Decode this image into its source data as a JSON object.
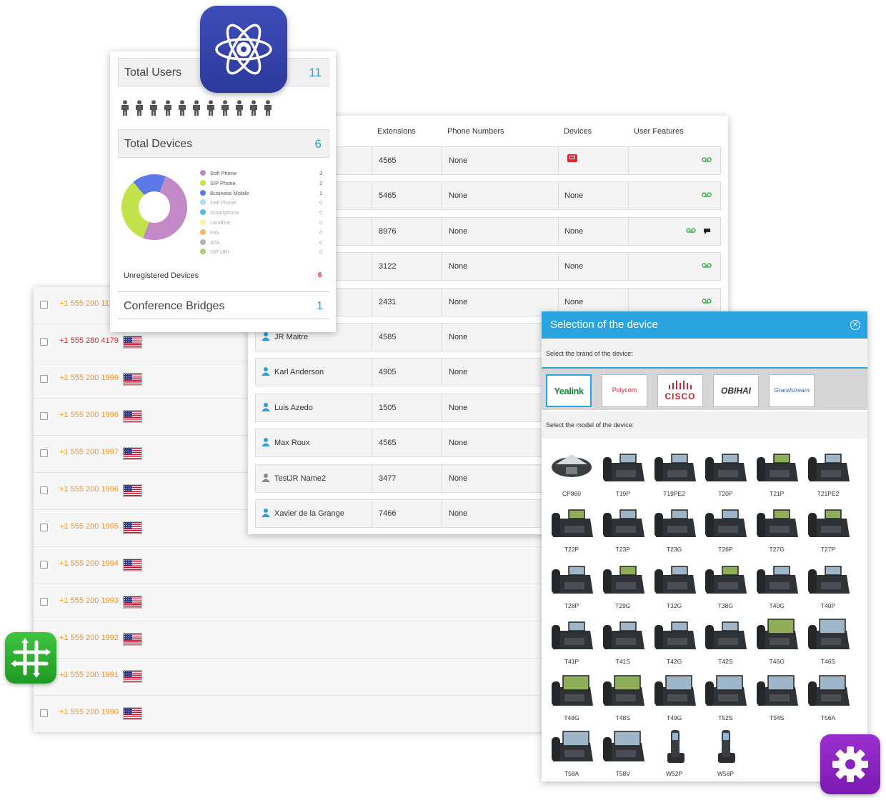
{
  "dashboard": {
    "total_users_label": "Total Users",
    "total_users_value": "11",
    "total_devices_label": "Total Devices",
    "total_devices_value": "6",
    "legend": [
      {
        "label": "Soft Phone",
        "count": "3",
        "color": "#c18ac6"
      },
      {
        "label": "SIP Phone",
        "count": "2",
        "color": "#c3e34c"
      },
      {
        "label": "Business Mobile",
        "count": "1",
        "color": "#5b78e6"
      },
      {
        "label": "Cell Phone",
        "count": "0",
        "color": "#a8dff7"
      },
      {
        "label": "Smartphone",
        "count": "0",
        "color": "#56b9e6"
      },
      {
        "label": "Landline",
        "count": "0",
        "color": "#fbf1a6"
      },
      {
        "label": "Fax",
        "count": "0",
        "color": "#f6b866"
      },
      {
        "label": "ATA",
        "count": "0",
        "color": "#b4b4b4"
      },
      {
        "label": "SIP URI",
        "count": "0",
        "color": "#a9d370"
      }
    ],
    "unregistered_label": "Unregistered Devices",
    "unregistered_value": "6",
    "conference_label": "Conference Bridges",
    "conference_value": "1"
  },
  "users_table": {
    "headers": [
      "Extensions",
      "Phone Numbers",
      "Devices",
      "User Features"
    ],
    "rows": [
      {
        "name": "",
        "ext": "4565",
        "phone": "None",
        "devices": "",
        "features": "vm"
      },
      {
        "name": "",
        "ext": "5465",
        "phone": "None",
        "devices": "None",
        "features": "vm"
      },
      {
        "name": "",
        "ext": "8976",
        "phone": "None",
        "devices": "None",
        "features": "vm-chat"
      },
      {
        "name": "",
        "ext": "3122",
        "phone": "None",
        "devices": "None",
        "features": "vm"
      },
      {
        "name": "",
        "ext": "2431",
        "phone": "None",
        "devices": "None",
        "features": "vm"
      },
      {
        "name": "JR Maitre",
        "ext": "4585",
        "phone": "None"
      },
      {
        "name": "Karl Anderson",
        "ext": "4905",
        "phone": "None"
      },
      {
        "name": "Luis Azedo",
        "ext": "1505",
        "phone": "None"
      },
      {
        "name": "Max Roux",
        "ext": "4565",
        "phone": "None"
      },
      {
        "name": "TestJR Name2",
        "ext": "3477",
        "phone": "None"
      },
      {
        "name": "Xavier de la Grange",
        "ext": "7466",
        "phone": "None"
      }
    ]
  },
  "numbers": [
    {
      "number": "+1 555 200 1111",
      "highlight": false
    },
    {
      "number": "+1 555 280 4179",
      "highlight": true
    },
    {
      "number": "+1 555 200 1999",
      "highlight": false
    },
    {
      "number": "+1 555 200 1998",
      "highlight": false
    },
    {
      "number": "+1 555 200 1997",
      "highlight": false
    },
    {
      "number": "+1 555 200 1996",
      "highlight": false
    },
    {
      "number": "+1 555 200 1995",
      "highlight": false
    },
    {
      "number": "+1 555 200 1994",
      "highlight": false
    },
    {
      "number": "+1 555 200 1993",
      "highlight": false
    },
    {
      "number": "+1 555 200 1992",
      "highlight": false
    },
    {
      "number": "+1 555 200 1991",
      "highlight": false
    },
    {
      "number": "+1 555 200 1990",
      "highlight": false
    }
  ],
  "device_modal": {
    "title": "Selection of the device",
    "brand_prompt": "Select the brand of the device:",
    "model_prompt": "Select the model of the device:",
    "brands": [
      "Yealink",
      "Polycom",
      "CISCO",
      "OBIHAI",
      "Grandstream"
    ],
    "models": [
      "CP860",
      "T19P",
      "T19PE2",
      "T20P",
      "T21P",
      "T21PE2",
      "T22P",
      "T23P",
      "T23G",
      "T26P",
      "T27G",
      "T27P",
      "T28P",
      "T29G",
      "T32G",
      "T38G",
      "T40G",
      "T40P",
      "T41P",
      "T41S",
      "T42G",
      "T42S",
      "T46G",
      "T46S",
      "T48G",
      "T48S",
      "T49G",
      "T52S",
      "T54S",
      "T56A",
      "T58A",
      "T58V",
      "W52P",
      "W56P"
    ]
  },
  "icons": {
    "top_app": "atom-gear-icon",
    "left_app": "hash-grid-icon",
    "bottom_app": "gear-icon"
  }
}
